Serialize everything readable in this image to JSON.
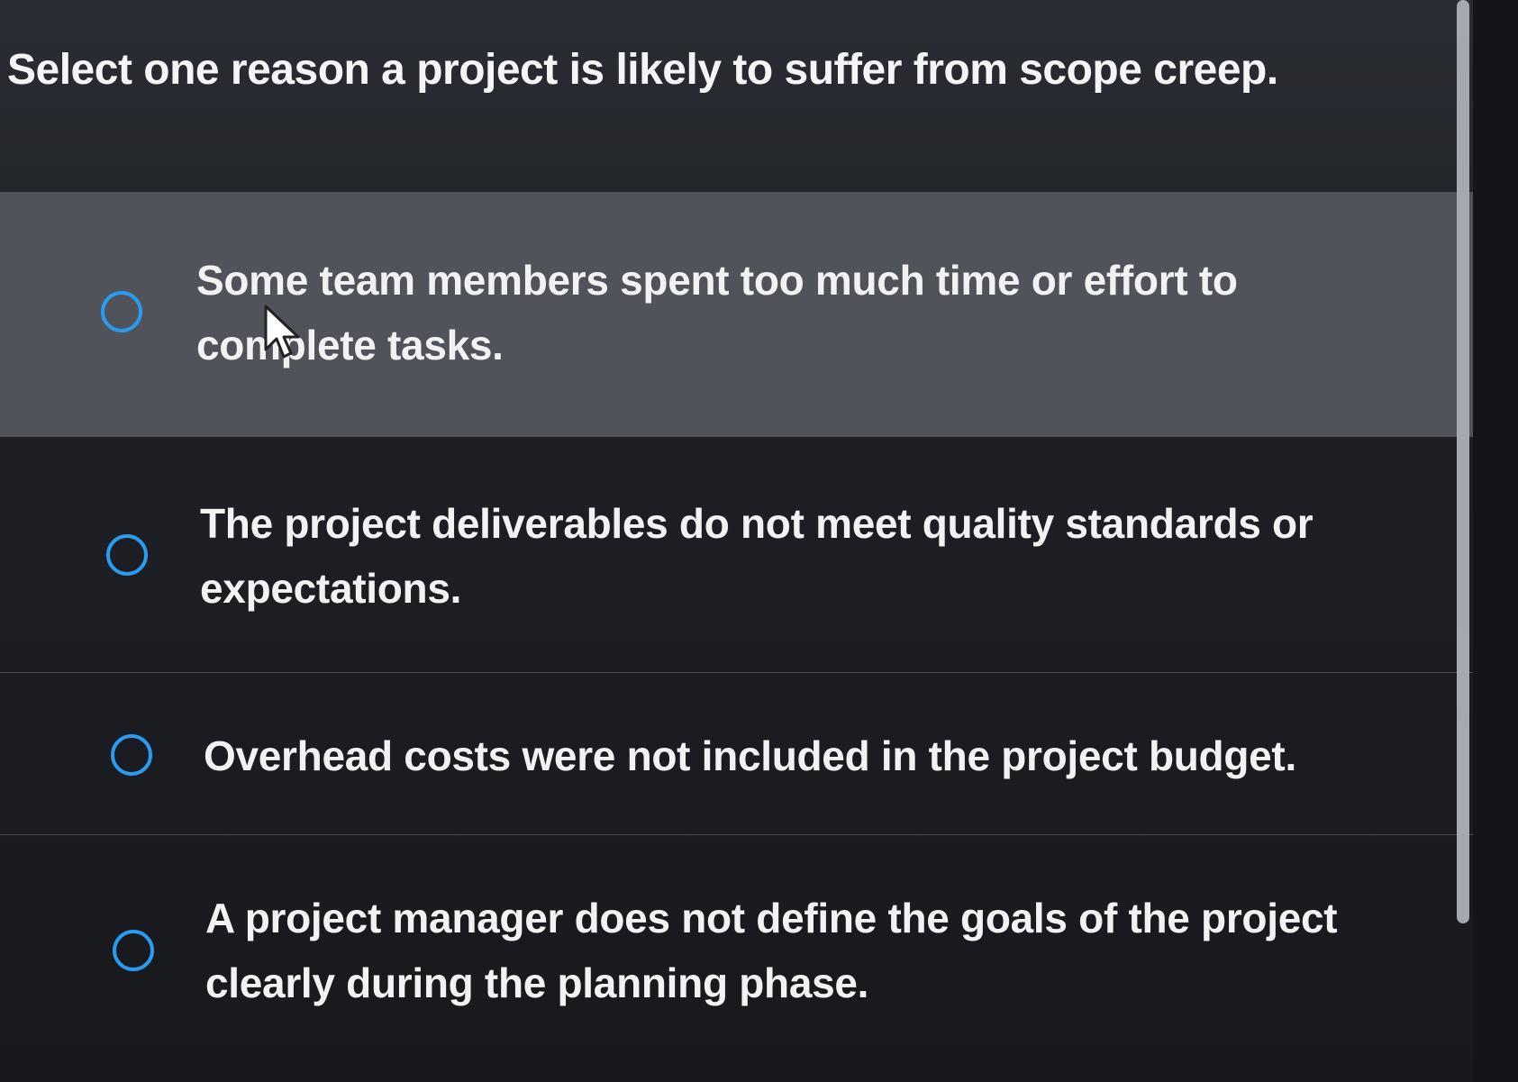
{
  "question": {
    "text": "Select one reason a project is likely to suffer from scope creep."
  },
  "options": [
    {
      "label": "Some team members spent too much time or effort to complete tasks.",
      "selected": false
    },
    {
      "label": "The project deliverables do not meet quality standards or expectations.",
      "selected": false
    },
    {
      "label": "Overhead costs were not included in the project budget.",
      "selected": false
    },
    {
      "label": "A project manager does not define the goals of the project clearly during the planning phase.",
      "selected": false
    }
  ],
  "colors": {
    "radio_accent": "#2a9cf0",
    "hover_row": "#50535a",
    "text": "#f2f2f2"
  },
  "icons": {
    "cursor": "mouse-pointer-icon",
    "radio": "radio-button-icon"
  }
}
